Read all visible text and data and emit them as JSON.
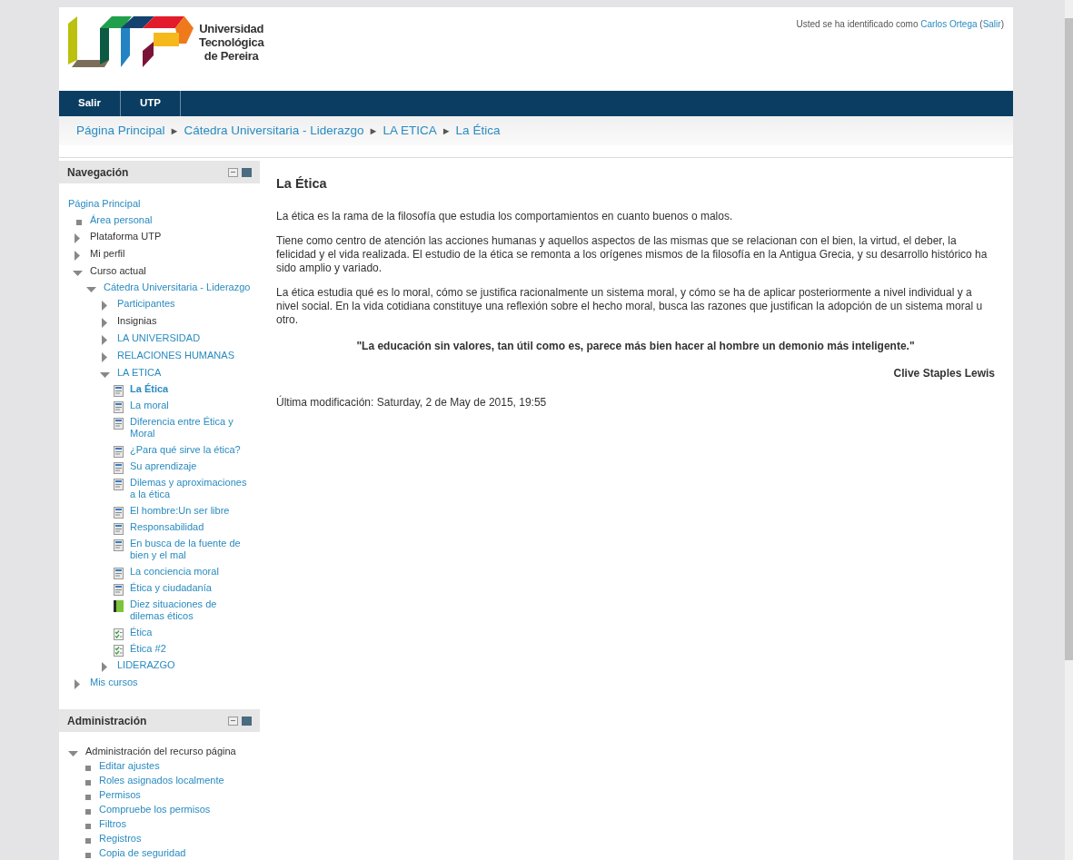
{
  "header": {
    "logo_lines": [
      "Universidad",
      "Tecnológica",
      "de Pereira"
    ],
    "user_info": {
      "prefix": "Usted se ha identificado como",
      "user": "Carlos Ortega",
      "open": "(",
      "logout": "Salir",
      "close": ")"
    }
  },
  "menu": [
    {
      "label": "Salir"
    },
    {
      "label": "UTP"
    }
  ],
  "breadcrumb": [
    "Página Principal",
    "Cátedra Universitaria - Liderazgo",
    "LA ETICA",
    "La Ética"
  ],
  "breadcrumb_separator": "►",
  "navigation": {
    "title": "Navegación",
    "tree": [
      {
        "label": "Página Principal",
        "kind": "root",
        "link": true,
        "selected": false,
        "children": [
          {
            "label": "Área personal",
            "kind": "leaf",
            "link": true,
            "selected": false
          },
          {
            "label": "Plataforma UTP",
            "kind": "branch",
            "expanded": false,
            "link": false,
            "selected": false
          },
          {
            "label": "Mi perfil",
            "kind": "branch",
            "expanded": false,
            "link": false,
            "selected": false
          },
          {
            "label": "Curso actual",
            "kind": "branch",
            "expanded": true,
            "link": false,
            "selected": false,
            "children": [
              {
                "label": "Cátedra Universitaria - Liderazgo",
                "kind": "branch",
                "expanded": true,
                "link": true,
                "selected": false,
                "children": [
                  {
                    "label": "Participantes",
                    "kind": "branch",
                    "expanded": false,
                    "link": true,
                    "selected": false
                  },
                  {
                    "label": "Insignias",
                    "kind": "branch",
                    "expanded": false,
                    "link": false,
                    "selected": false
                  },
                  {
                    "label": "LA UNIVERSIDAD",
                    "kind": "branch",
                    "expanded": false,
                    "link": true,
                    "selected": false
                  },
                  {
                    "label": "RELACIONES HUMANAS",
                    "kind": "branch",
                    "expanded": false,
                    "link": true,
                    "selected": false
                  },
                  {
                    "label": "LA ETICA",
                    "kind": "branch",
                    "expanded": true,
                    "link": true,
                    "selected": false,
                    "children": [
                      {
                        "label": "La Ética",
                        "kind": "page",
                        "link": true,
                        "selected": true
                      },
                      {
                        "label": "La moral",
                        "kind": "page",
                        "link": true,
                        "selected": false
                      },
                      {
                        "label": "Diferencia entre Ética y Moral",
                        "kind": "page",
                        "link": true,
                        "selected": false
                      },
                      {
                        "label": "¿Para qué sirve la ética?",
                        "kind": "page",
                        "link": true,
                        "selected": false
                      },
                      {
                        "label": "Su aprendizaje",
                        "kind": "page",
                        "link": true,
                        "selected": false
                      },
                      {
                        "label": "Dilemas y aproximaciones a la ética",
                        "kind": "page",
                        "link": true,
                        "selected": false
                      },
                      {
                        "label": "El hombre:Un ser libre",
                        "kind": "page",
                        "link": true,
                        "selected": false
                      },
                      {
                        "label": "Responsabilidad",
                        "kind": "page",
                        "link": true,
                        "selected": false
                      },
                      {
                        "label": "En busca de la fuente de bien y el mal",
                        "kind": "page",
                        "link": true,
                        "selected": false
                      },
                      {
                        "label": "La conciencia moral",
                        "kind": "page",
                        "link": true,
                        "selected": false
                      },
                      {
                        "label": "Ética y ciudadanía",
                        "kind": "page",
                        "link": true,
                        "selected": false
                      },
                      {
                        "label": "Diez situaciones de dilemas éticos",
                        "kind": "book",
                        "link": true,
                        "selected": false
                      },
                      {
                        "label": "Ética",
                        "kind": "quiz",
                        "link": true,
                        "selected": false
                      },
                      {
                        "label": "Ética #2",
                        "kind": "quiz",
                        "link": true,
                        "selected": false
                      }
                    ]
                  },
                  {
                    "label": "LIDERAZGO",
                    "kind": "branch",
                    "expanded": false,
                    "link": true,
                    "selected": false
                  }
                ]
              }
            ]
          },
          {
            "label": "Mis cursos",
            "kind": "branch",
            "expanded": false,
            "link": true,
            "selected": false
          }
        ]
      }
    ]
  },
  "administration": {
    "title": "Administración",
    "tree": [
      {
        "label": "Administración del recurso página",
        "kind": "branch",
        "expanded": true,
        "link": false,
        "selected": false,
        "children": [
          {
            "label": "Editar ajustes",
            "kind": "leaf",
            "link": true,
            "selected": false
          },
          {
            "label": "Roles asignados localmente",
            "kind": "leaf",
            "link": true,
            "selected": false
          },
          {
            "label": "Permisos",
            "kind": "leaf",
            "link": true,
            "selected": false
          },
          {
            "label": "Compruebe los permisos",
            "kind": "leaf",
            "link": true,
            "selected": false
          },
          {
            "label": "Filtros",
            "kind": "leaf",
            "link": true,
            "selected": false
          },
          {
            "label": "Registros",
            "kind": "leaf",
            "link": true,
            "selected": false
          },
          {
            "label": "Copia de seguridad",
            "kind": "leaf",
            "link": true,
            "selected": false
          }
        ]
      }
    ]
  },
  "content": {
    "title": "La Ética",
    "paragraphs": [
      "La ética es la rama de la filosofía que estudia los comportamientos en cuanto buenos o malos.",
      "Tiene como centro de atención las acciones humanas y aquellos aspectos de las mismas que se relacionan con el bien, la virtud, el deber, la felicidad y el vida realizada. El estudio de la ética se remonta a los orígenes mismos de la filosofía en la Antigua Grecia, y su desarrollo histórico ha sido amplio y variado.",
      "La ética estudia qué es lo moral, cómo se justifica racionalmente un sistema moral, y cómo se ha de aplicar posteriormente a nivel individual y a nivel social. En la vida cotidiana constituye una reflexión sobre el hecho moral, busca las razones que justifican la adopción de un sistema moral u otro."
    ],
    "quote": "\"La educación sin valores, tan útil como es, parece más bien hacer al hombre un demonio más inteligente.\"",
    "author": "Clive Staples Lewis",
    "last_modified": "Última modificación: Saturday, 2 de May de 2015, 19:55"
  }
}
